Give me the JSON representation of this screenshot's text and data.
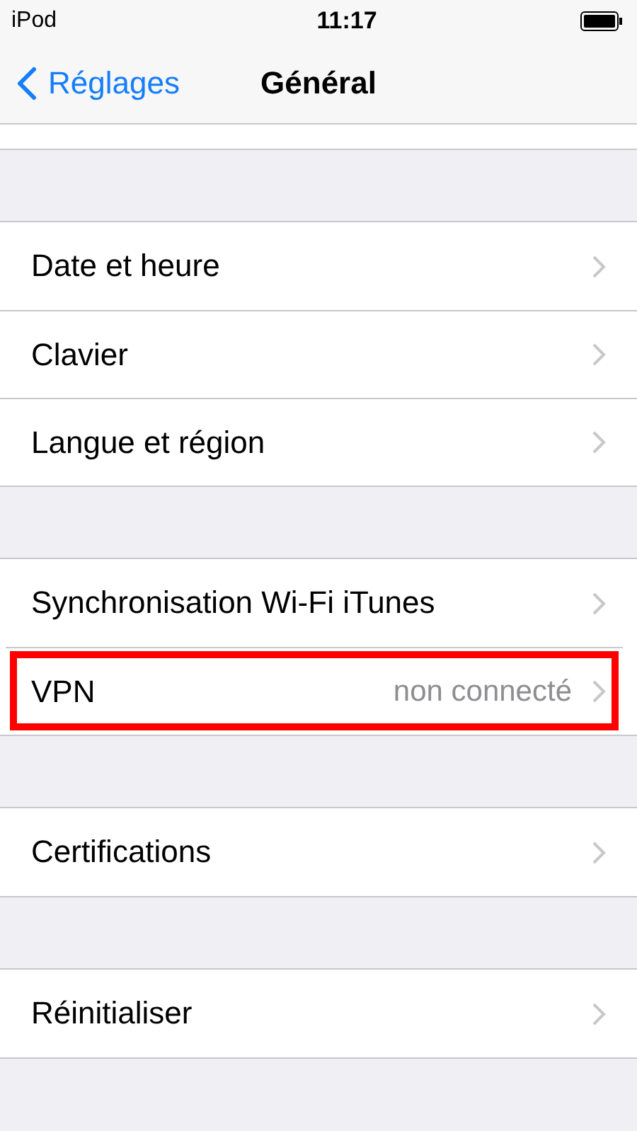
{
  "status_bar": {
    "carrier": "iPod",
    "time": "11:17"
  },
  "nav": {
    "back": "Réglages",
    "title": "Général"
  },
  "groups": [
    {
      "rows": [
        {
          "label": "Date et heure",
          "highlighted": false
        },
        {
          "label": "Clavier",
          "highlighted": false
        },
        {
          "label": "Langue et région",
          "highlighted": false
        }
      ]
    },
    {
      "rows": [
        {
          "label": "Synchronisation Wi-Fi iTunes",
          "highlighted": false
        },
        {
          "label": "VPN",
          "value": "non connecté",
          "highlighted": true
        }
      ]
    },
    {
      "rows": [
        {
          "label": "Certifications",
          "highlighted": false
        }
      ]
    },
    {
      "rows": [
        {
          "label": "Réinitialiser",
          "highlighted": false
        }
      ]
    }
  ]
}
